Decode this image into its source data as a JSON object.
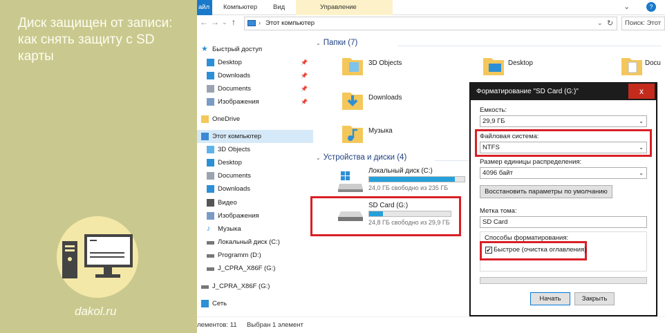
{
  "left_panel": {
    "title": "Диск защищен от записи: как снять защиту с SD карты",
    "brand": "dakol.ru",
    "bg": "#c9c98f"
  },
  "ribbon": {
    "tabs": [
      "айл",
      "Компьютер",
      "Вид",
      "Управление"
    ]
  },
  "address": {
    "path": "Этот компьютер",
    "search_placeholder": "Поиск: Этот"
  },
  "nav": {
    "items": [
      {
        "label": "Быстрый доступ",
        "icon": "star-icon"
      },
      {
        "label": "Desktop",
        "icon": "desktop-icon",
        "pin": true
      },
      {
        "label": "Downloads",
        "icon": "download-icon",
        "pin": true
      },
      {
        "label": "Documents",
        "icon": "documents-icon",
        "pin": true
      },
      {
        "label": "Изображения",
        "icon": "pictures-icon",
        "pin": true
      },
      {
        "label": "OneDrive",
        "icon": "folder-icon"
      },
      {
        "label": "Этот компьютер",
        "icon": "computer-icon"
      },
      {
        "label": "3D Objects",
        "icon": "cube-icon"
      },
      {
        "label": "Desktop",
        "icon": "desktop-icon"
      },
      {
        "label": "Documents",
        "icon": "documents-icon"
      },
      {
        "label": "Downloads",
        "icon": "download-icon"
      },
      {
        "label": "Видео",
        "icon": "video-icon"
      },
      {
        "label": "Изображения",
        "icon": "pictures-icon"
      },
      {
        "label": "Музыка",
        "icon": "music-icon"
      },
      {
        "label": "Локальный диск (C:)",
        "icon": "drive-icon"
      },
      {
        "label": "Programm (D:)",
        "icon": "drive-icon"
      },
      {
        "label": "J_CPRA_X86F (G:)",
        "icon": "drive-icon"
      },
      {
        "label": "J_CPRA_X86F (G:)",
        "icon": "drive-icon"
      },
      {
        "label": "Сеть",
        "icon": "network-icon"
      }
    ]
  },
  "content": {
    "folders_header": "Папки (7)",
    "folders": [
      "3D Objects",
      "Desktop",
      "Docu",
      "Downloads",
      "Музыка"
    ],
    "devices_header": "Устройства и диски (4)",
    "drives": [
      {
        "name": "Локальный диск (C:)",
        "free": "24,0 ГБ свободно из 235 ГБ",
        "used": 0.9
      },
      {
        "name": "SD Card (G:)",
        "free": "24,8 ГБ свободно из 29,9 ГБ",
        "used": 0.17
      }
    ]
  },
  "status": {
    "count": "лементов: 11",
    "selected": "Выбран 1 элемент"
  },
  "dialog": {
    "title": "Форматирование \"SD Card (G:)\"",
    "close": "x",
    "capacity_label": "Емкость:",
    "capacity": "29,9 ГБ",
    "fs_label": "Файловая система:",
    "fs": "NTFS",
    "alloc_label": "Размер единицы распределения:",
    "alloc": "4096 байт",
    "restore_btn": "Восстановить параметры по умолчанию",
    "volume_label": "Метка тома:",
    "volume": "SD Card",
    "format_opts": "Способы форматирования:",
    "quick": "Быстрое (очистка оглавления)",
    "start_btn": "Начать",
    "close_btn": "Закрыть"
  },
  "colors": {
    "accent": "#1979ca",
    "highlight": "#d91f26",
    "bar": "#26a0da"
  }
}
